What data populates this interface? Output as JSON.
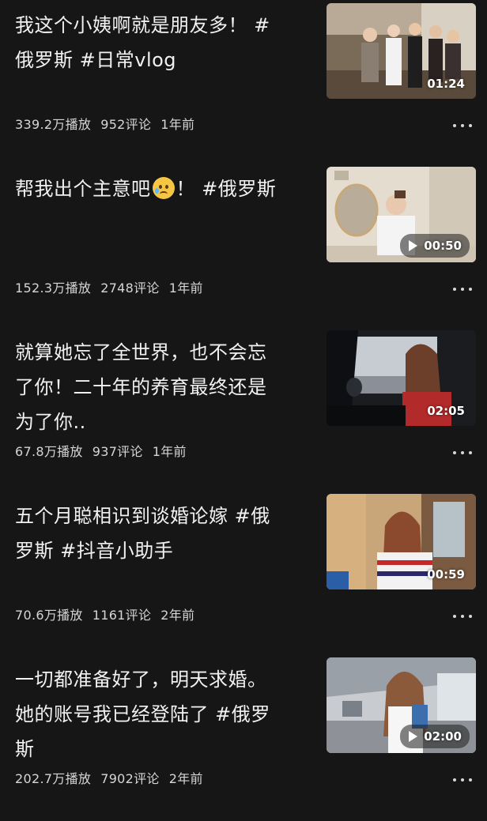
{
  "videos": [
    {
      "title": "我这个小姨啊就是朋友多！ #\n俄罗斯 #日常vlog",
      "duration": "01:24",
      "plays": "339.2万播放",
      "comments": "952评论",
      "age": "1年前"
    },
    {
      "title_pre": "帮我出个主意吧",
      "emoji": "sad-tear-emoji",
      "title_post": "！ #俄罗斯",
      "duration": "00:50",
      "plays": "152.3万播放",
      "comments": "2748评论",
      "age": "1年前"
    },
    {
      "title": "就算她忘了全世界，也不会忘\n了你！二十年的养育最终还是\n为了你..",
      "duration": "02:05",
      "plays": "67.8万播放",
      "comments": "937评论",
      "age": "1年前"
    },
    {
      "title": "五个月聪相识到谈婚论嫁 #俄\n罗斯 #抖音小助手",
      "duration": "00:59",
      "plays": "70.6万播放",
      "comments": "1161评论",
      "age": "2年前"
    },
    {
      "title": "一切都准备好了，明天求婚。\n她的账号我已经登陆了 #俄罗\n斯",
      "duration": "02:00",
      "plays": "202.7万播放",
      "comments": "7902评论",
      "age": "2年前"
    }
  ],
  "icons": {
    "more": "more-dots-icon",
    "play": "play-icon"
  }
}
